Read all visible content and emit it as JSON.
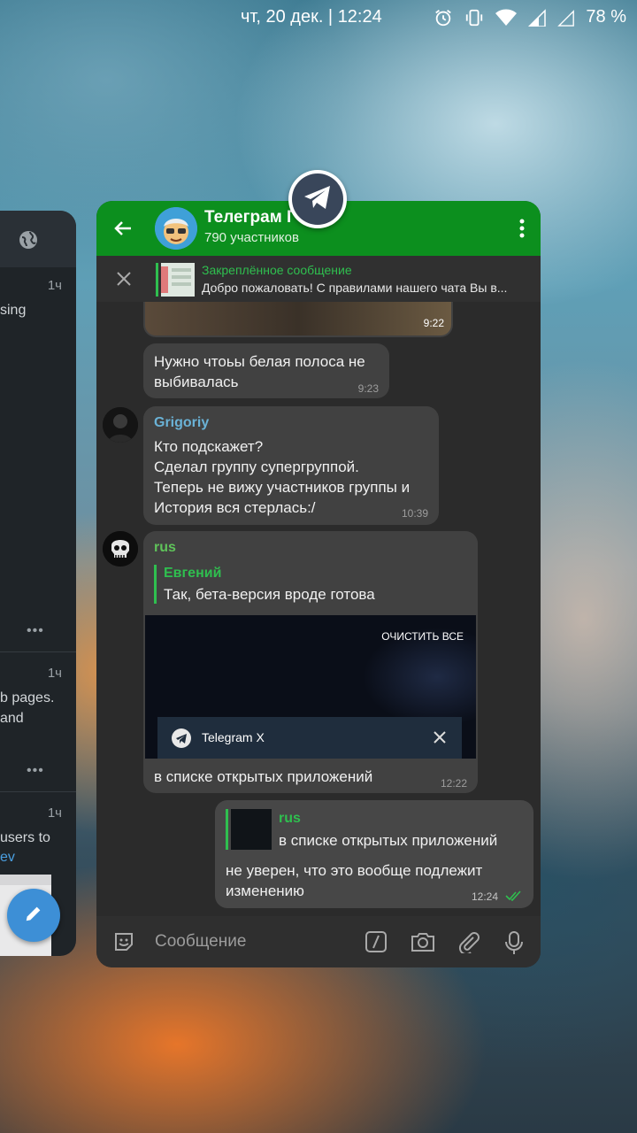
{
  "status": {
    "datetime": "чт, 20 дек. | 12:24",
    "battery": "78 %"
  },
  "left_card": {
    "item1_time": "1ч",
    "item1_text": "sing",
    "item2_time": "1ч",
    "item2_text_a": "b pages.",
    "item2_text_b": "and",
    "item3_time": "1ч",
    "item3_text_a": "users to",
    "item3_text_b": "ev"
  },
  "chat": {
    "title": "Телеграм Г",
    "subtitle": "790 участников",
    "pinned": {
      "label": "Закреплённое сообщение",
      "text": "Добро пожаловать! С правилами нашего чата Вы в..."
    },
    "messages": [
      {
        "time": "9:22"
      },
      {
        "text": "Нужно чтоьы белая полоса не выбивалась",
        "time": "9:23"
      },
      {
        "sender": "Grigoriy",
        "text": "Кто подскажет?\nСделал группу супергруппой.\nТеперь не вижу участников группы и История вся стерлась:/",
        "time": "10:39"
      },
      {
        "sender": "rus",
        "reply_name": "Евгений",
        "reply_text": "Так, бета-версия вроде готова",
        "screenshot": {
          "clear_all": "ОЧИСТИТЬ ВСЕ",
          "app_name": "Telegram X"
        },
        "text": "в списке открытых приложений",
        "time": "12:22"
      },
      {
        "reply_name": "rus",
        "reply_text": "в списке открытых приложений",
        "text": "не уверен, что это вообще подлежит изменению",
        "time": "12:24"
      }
    ],
    "input_placeholder": "Сообщение"
  },
  "colors": {
    "header": "#0c8f1e",
    "accent_green": "#2fbf4f",
    "bubble": "#414141",
    "grigoriy_name": "#6ab2d6",
    "rus_name": "#5fc35a"
  }
}
